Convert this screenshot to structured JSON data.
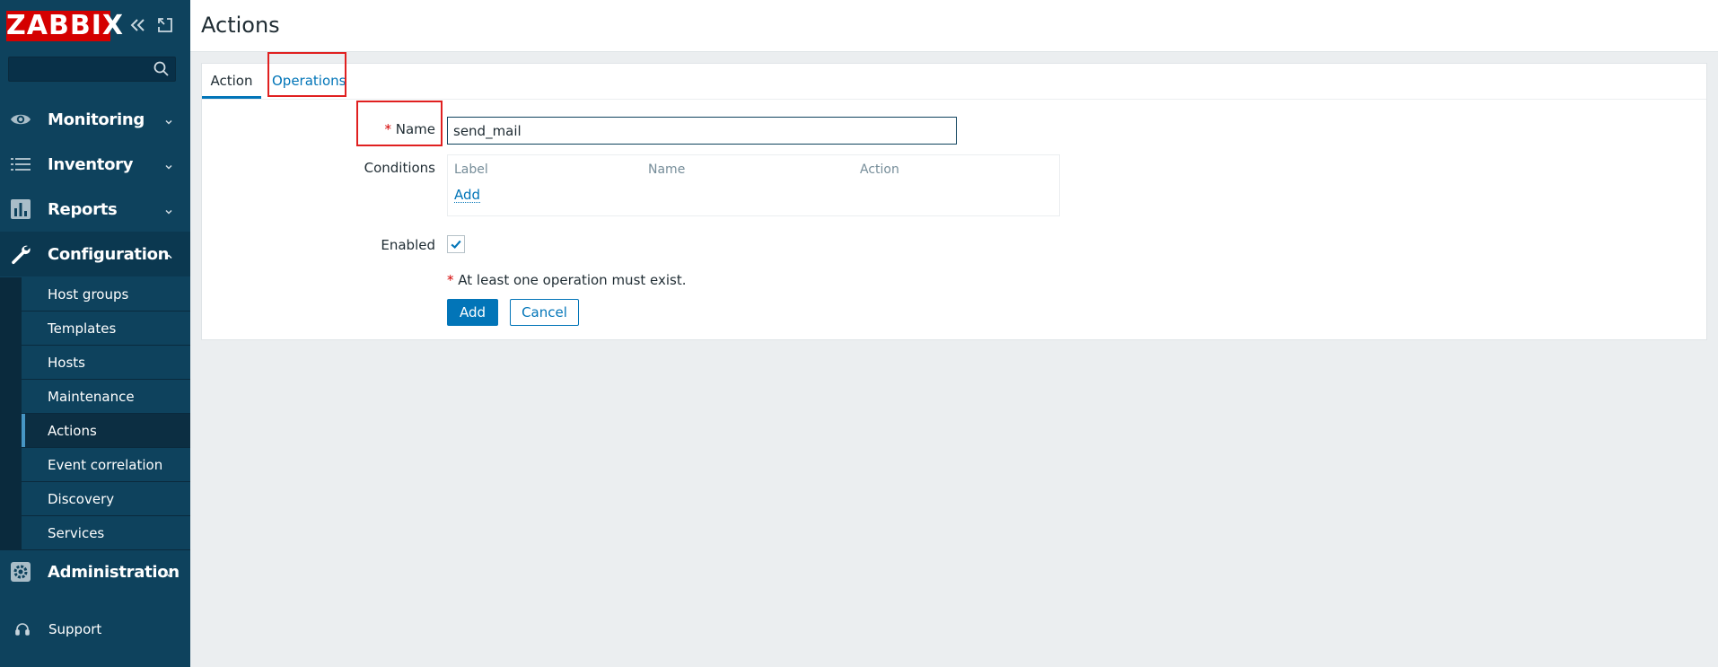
{
  "sidebar": {
    "logo": "ZABBIX",
    "search": {
      "value": "",
      "placeholder": ""
    },
    "menu": [
      {
        "label": "Monitoring",
        "icon": "eye-icon"
      },
      {
        "label": "Inventory",
        "icon": "list-icon"
      },
      {
        "label": "Reports",
        "icon": "bar-chart-icon"
      },
      {
        "label": "Configuration",
        "icon": "wrench-icon"
      },
      {
        "label": "Administration",
        "icon": "gear-icon"
      }
    ],
    "configuration_items": [
      "Host groups",
      "Templates",
      "Hosts",
      "Maintenance",
      "Actions",
      "Event correlation",
      "Discovery",
      "Services"
    ],
    "active_item": "Actions",
    "support_label": "Support"
  },
  "header": {
    "title": "Actions"
  },
  "form": {
    "tabs": [
      "Action",
      "Operations"
    ],
    "active_tab": "Action",
    "required_mark": "*",
    "name_label": "Name",
    "name_value": "send_mail",
    "conditions_label": "Conditions",
    "conditions_columns": [
      "Label",
      "Name",
      "Action"
    ],
    "conditions_add": "Add",
    "enabled_label": "Enabled",
    "enabled": true,
    "operations_hint": "At least one operation must exist.",
    "add_button": "Add",
    "cancel_button": "Cancel"
  },
  "colors": {
    "sidebar_bg": "#0e425d",
    "logo_bg": "#d40000",
    "accent": "#0275b8",
    "highlight": "#e02020"
  }
}
